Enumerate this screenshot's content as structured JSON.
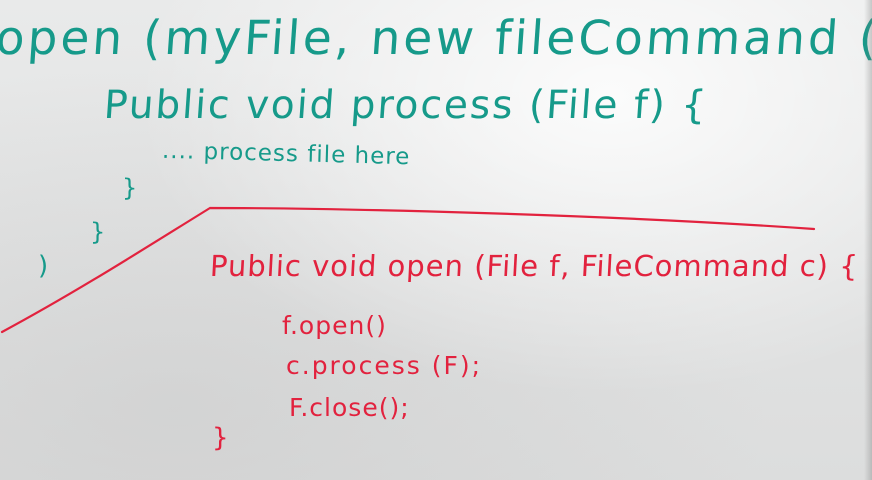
{
  "whiteboard": {
    "teal_code": {
      "line1": "open (myFile, new fileCommand () {",
      "line2": "Public void process (File f) {",
      "line3": ".... process file here",
      "brace_inner": "}",
      "brace_outer": "}",
      "paren_close": ")"
    },
    "red_code": {
      "line1": "Public void open (File f, FileCommand c) {",
      "line2": "f.open()",
      "line3": "c.process (F);",
      "line4": "F.close();",
      "brace_close": "}"
    }
  },
  "colors": {
    "teal_marker": "#169a8a",
    "red_marker": "#e2223e",
    "board": "#e4e5e5"
  }
}
